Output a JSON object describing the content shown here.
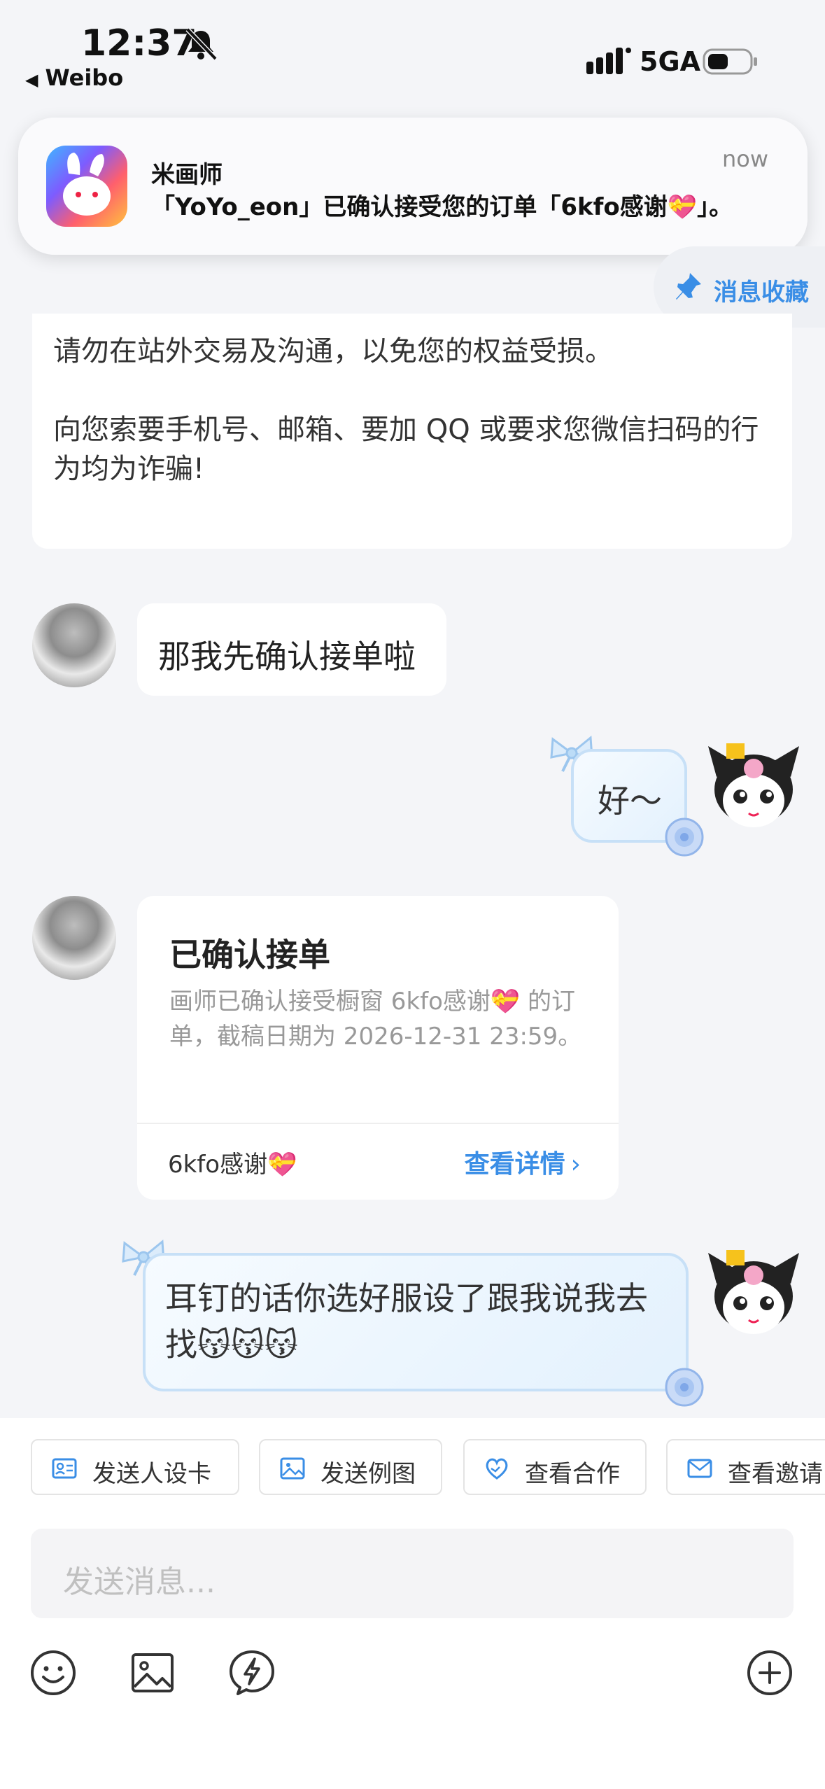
{
  "status_bar": {
    "time": "12:37",
    "back_app": "Weibo",
    "network": "5GA"
  },
  "notification": {
    "app_name": "米画师",
    "body": "「YoYo_eon」已确认接受您的订单「6kfo感谢💝」。",
    "time": "now"
  },
  "collect_button": {
    "label": "消息收藏"
  },
  "warning_card": {
    "text": "请勿在站外交易及沟通，以免您的权益受损。\n\n向您索要手机号、邮箱、要加 QQ 或要求您微信扫码的行为均为诈骗!"
  },
  "messages": [
    {
      "side": "left",
      "text": "那我先确认接单啦"
    },
    {
      "side": "right",
      "text": "好～"
    },
    {
      "side": "right",
      "text": "耳钉的话你选好服设了跟我说我去找😽😽😽"
    }
  ],
  "order_card": {
    "title": "已确认接单",
    "description": "画师已确认接受橱窗 6kfo感谢💝 的订单，截稿日期为 2026-12-31 23:59。",
    "name": "6kfo感谢💝",
    "link_label": "查看详情"
  },
  "quick_actions": [
    {
      "label": "发送人设卡",
      "icon": "id-card-icon"
    },
    {
      "label": "发送例图",
      "icon": "image-icon"
    },
    {
      "label": "查看合作",
      "icon": "handshake-heart-icon"
    },
    {
      "label": "查看邀请",
      "icon": "envelope-icon"
    }
  ],
  "input": {
    "placeholder": "发送消息..."
  },
  "toolbar": [
    "emoji-icon",
    "image-icon",
    "lightning-icon",
    "plus-icon"
  ],
  "colors": {
    "accent": "#3a8ee6",
    "background": "#f4f5f8"
  }
}
